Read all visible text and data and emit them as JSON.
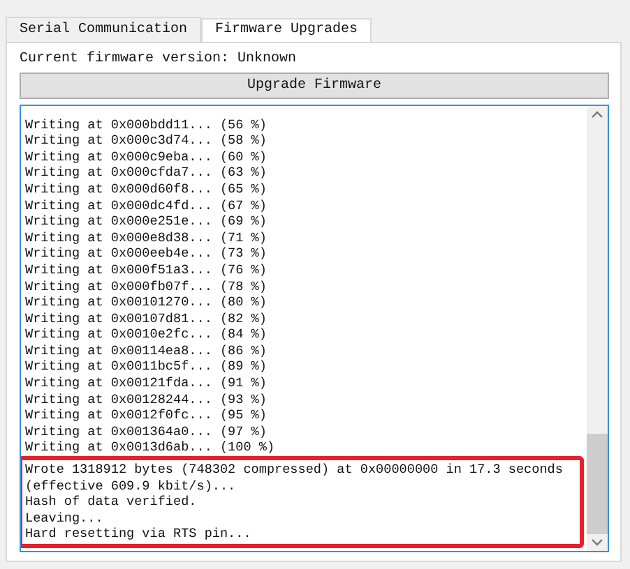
{
  "tabs": [
    {
      "label": "Serial Communication",
      "selected": false
    },
    {
      "label": "Firmware  Upgrades",
      "selected": true
    }
  ],
  "firmware_version": "Current firmware version: Unknown",
  "upgrade_button": "Upgrade Firmware",
  "log": {
    "lines": [
      "Writing at 0x000bdd11... (56 %)",
      "Writing at 0x000c3d74... (58 %)",
      "Writing at 0x000c9eba... (60 %)",
      "Writing at 0x000cfda7... (63 %)",
      "Writing at 0x000d60f8... (65 %)",
      "Writing at 0x000dc4fd... (67 %)",
      "Writing at 0x000e251e... (69 %)",
      "Writing at 0x000e8d38... (71 %)",
      "Writing at 0x000eeb4e... (73 %)",
      "Writing at 0x000f51a3... (76 %)",
      "Writing at 0x000fb07f... (78 %)",
      "Writing at 0x00101270... (80 %)",
      "Writing at 0x00107d81... (82 %)",
      "Writing at 0x0010e2fc... (84 %)",
      "Writing at 0x00114ea8... (86 %)",
      "Writing at 0x0011bc5f... (89 %)",
      "Writing at 0x00121fda... (91 %)",
      "Writing at 0x00128244... (93 %)",
      "Writing at 0x0012f0fc... (95 %)",
      "Writing at 0x001364a0... (97 %)",
      "Writing at 0x0013d6ab... (100 %)"
    ],
    "highlighted_lines": [
      "Wrote 1318912 bytes (748302 compressed) at 0x00000000 in 17.3 seconds (effective 609.9 kbit/s)...",
      "Hash of data verified.",
      "Leaving...",
      "Hard resetting via RTS pin..."
    ]
  }
}
